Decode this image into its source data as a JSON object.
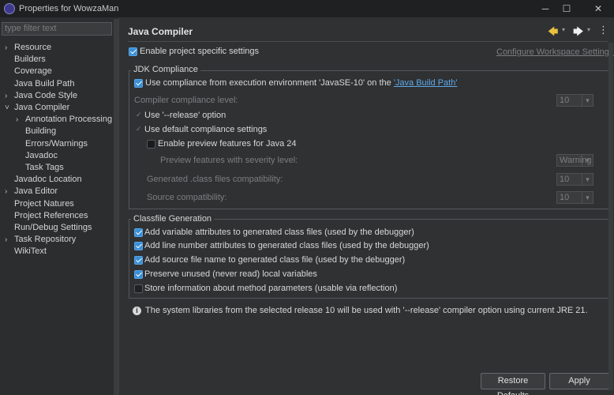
{
  "window": {
    "title": "Properties for WowzaMan",
    "min": "─",
    "max": "☐",
    "close": "✕"
  },
  "sidebar": {
    "filter_placeholder": "type filter text",
    "items": [
      {
        "label": "Resource",
        "chev": "›"
      },
      {
        "label": "Builders",
        "chev": ""
      },
      {
        "label": "Coverage",
        "chev": ""
      },
      {
        "label": "Java Build Path",
        "chev": ""
      },
      {
        "label": "Java Code Style",
        "chev": "›"
      },
      {
        "label": "Java Compiler",
        "chev": "˅"
      },
      {
        "label": "Annotation Processing",
        "chev": "›"
      },
      {
        "label": "Building",
        "chev": ""
      },
      {
        "label": "Errors/Warnings",
        "chev": ""
      },
      {
        "label": "Javadoc",
        "chev": ""
      },
      {
        "label": "Task Tags",
        "chev": ""
      },
      {
        "label": "Javadoc Location",
        "chev": ""
      },
      {
        "label": "Java Editor",
        "chev": "›"
      },
      {
        "label": "Project Natures",
        "chev": ""
      },
      {
        "label": "Project References",
        "chev": ""
      },
      {
        "label": "Run/Debug Settings",
        "chev": ""
      },
      {
        "label": "Task Repository",
        "chev": "›"
      },
      {
        "label": "WikiText",
        "chev": ""
      }
    ]
  },
  "page": {
    "title": "Java Compiler",
    "enable_specific": "Enable project specific settings",
    "configure_link": "Configure Workspace Settings...",
    "jdk": {
      "group_title": "JDK Compliance",
      "use_compliance_prefix": "Use compliance from execution environment 'JavaSE-10' on the ",
      "use_compliance_link": "'Java Build Path'",
      "compliance_level": "Compiler compliance level:",
      "compliance_value": "10",
      "use_release": "Use '--release' option",
      "use_default": "Use default compliance settings",
      "enable_preview": "Enable preview features for Java 24",
      "preview_severity": "Preview features with severity level:",
      "preview_value": "Warning",
      "generated_compat": "Generated .class files compatibility:",
      "generated_value": "10",
      "source_compat": "Source compatibility:",
      "source_value": "10"
    },
    "classfile": {
      "group_title": "Classfile Generation",
      "items": [
        "Add variable attributes to generated class files (used by the debugger)",
        "Add line number attributes to generated class files (used by the debugger)",
        "Add source file name to generated class file (used by the debugger)",
        "Preserve unused (never read) local variables",
        "Store information about method parameters (usable via reflection)"
      ]
    },
    "info": "The system libraries from the selected release 10 will be used with '--release' compiler option using current JRE 21."
  },
  "buttons": {
    "restore": "Restore Defaults",
    "apply": "Apply"
  },
  "colors": {
    "accent": "#3b8fd6",
    "link": "#5fa8e8",
    "nav_arrow": "#e8c040"
  }
}
